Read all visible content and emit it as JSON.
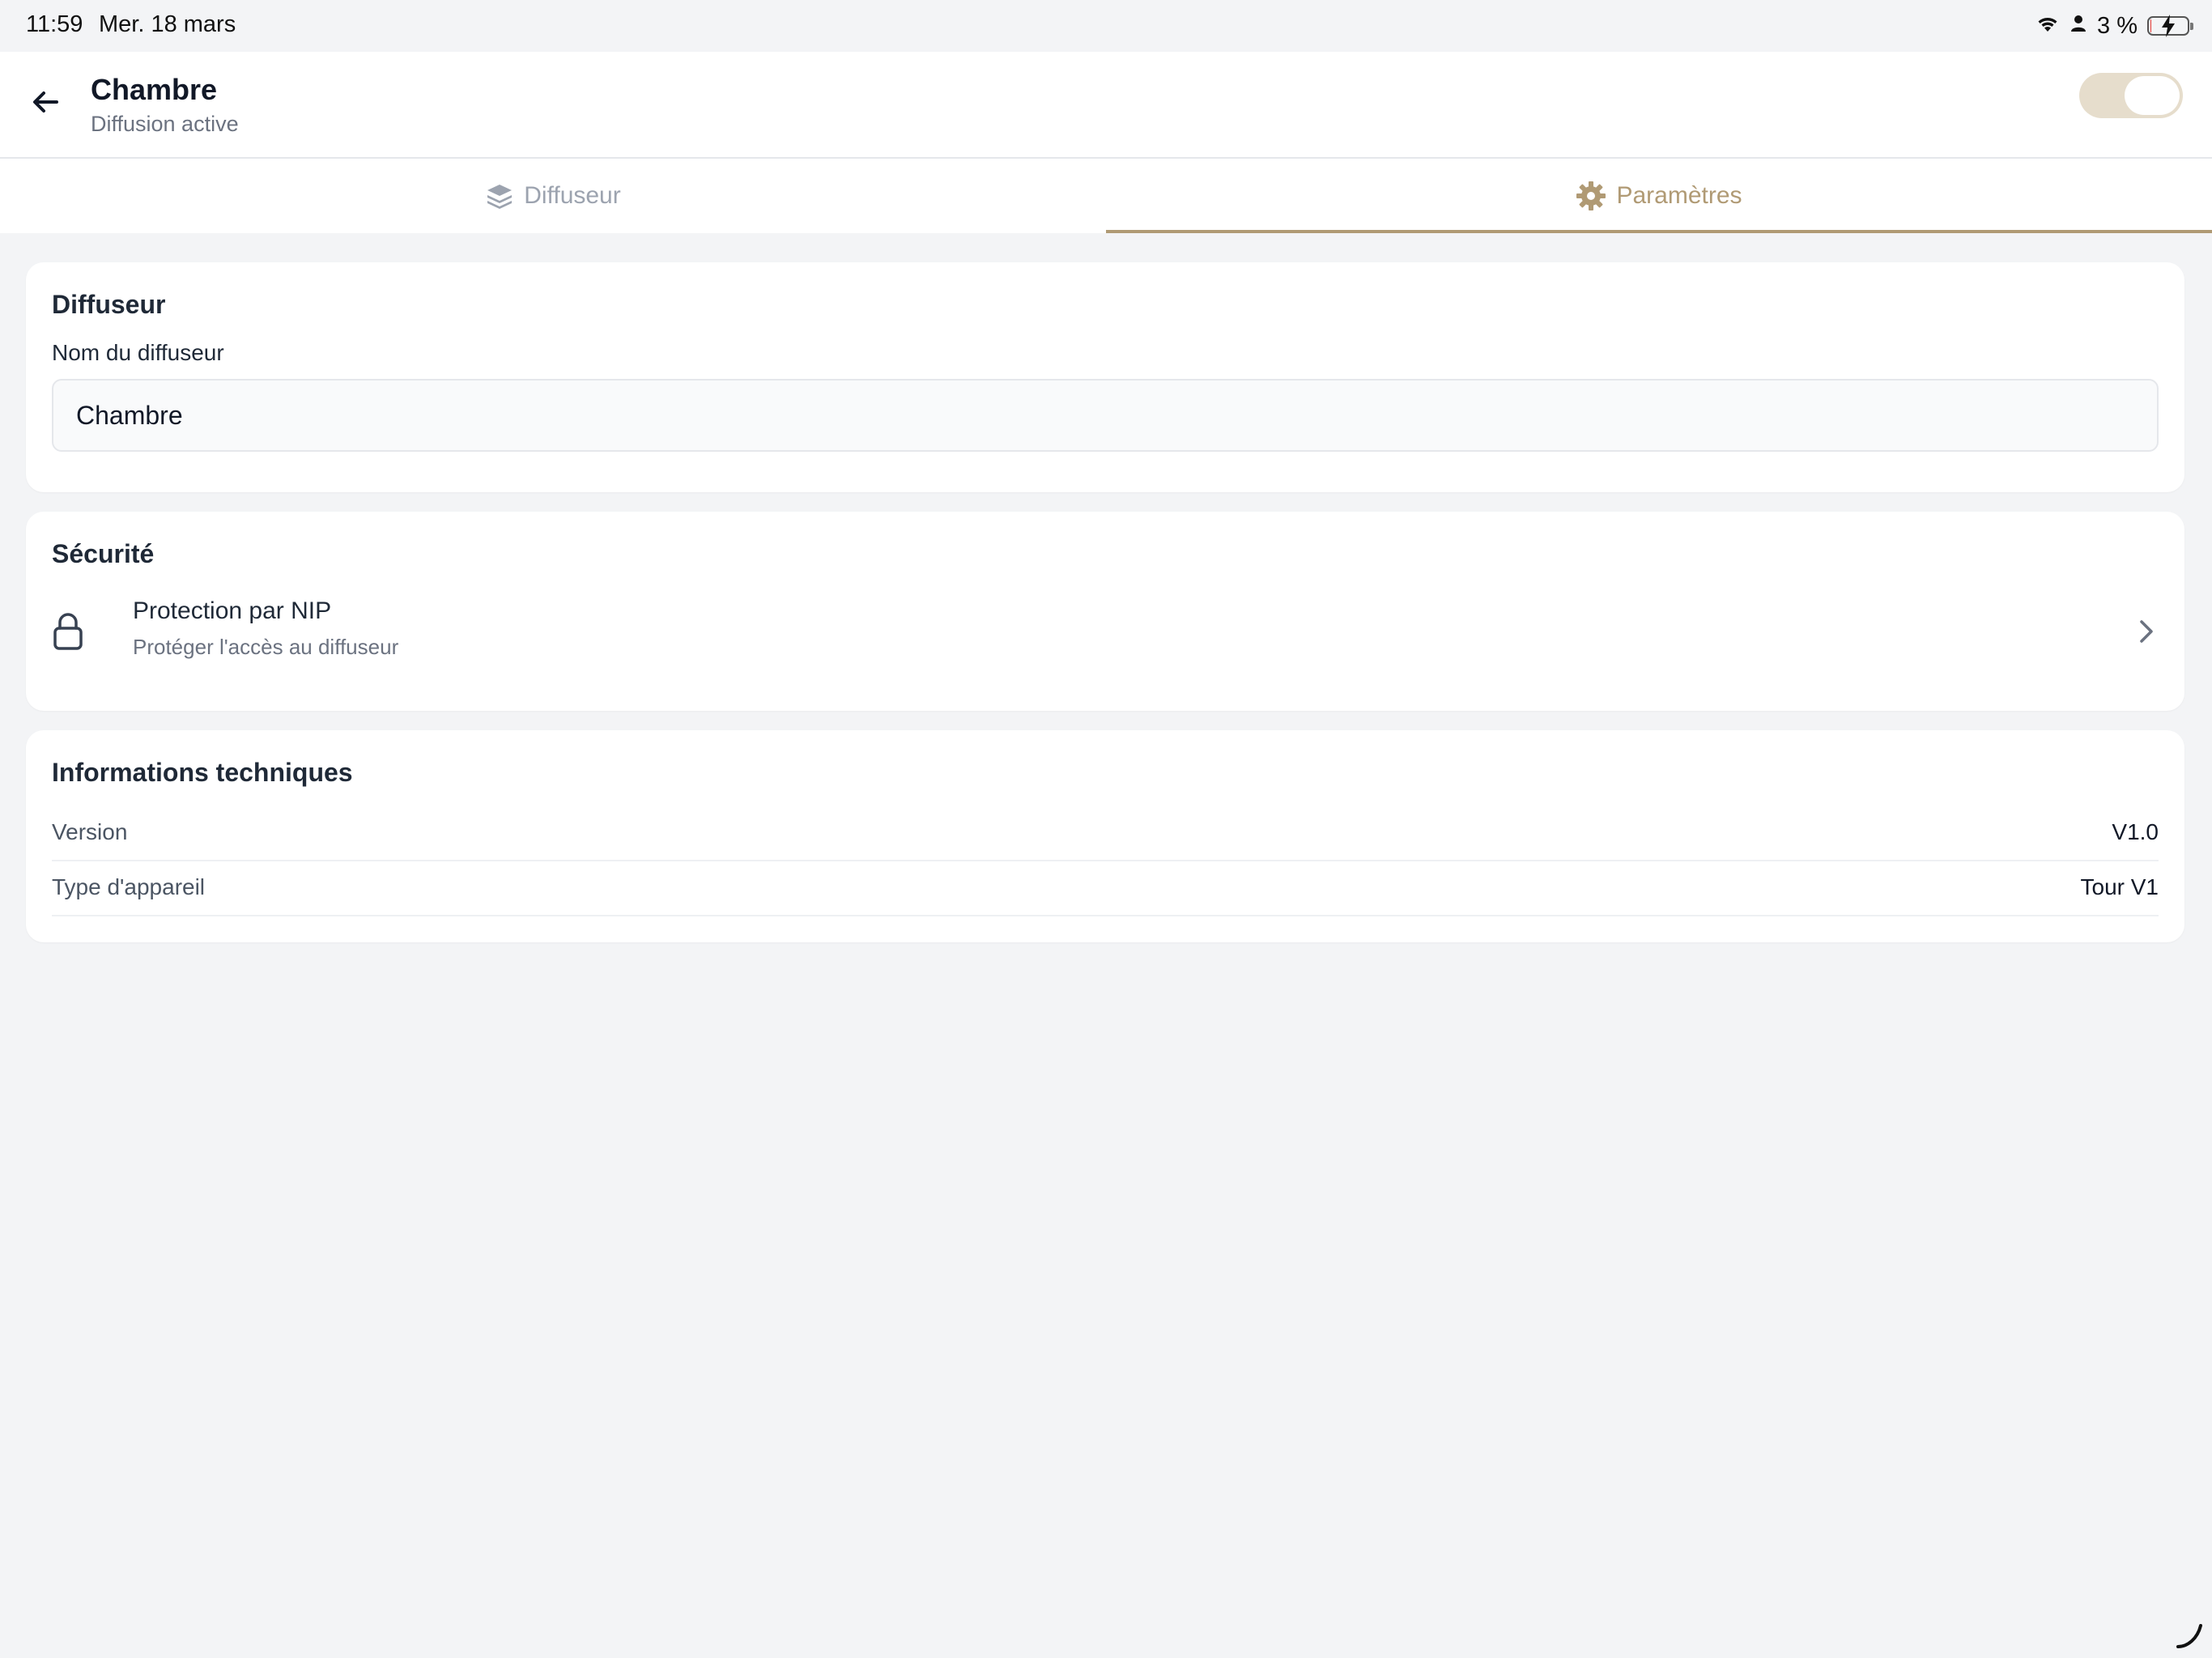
{
  "status_bar": {
    "time": "11:59",
    "date": "Mer. 18 mars",
    "battery_percent": "3 %",
    "battery_level": 0.03,
    "icons": [
      "wifi-icon",
      "person-icon",
      "battery-charging-icon"
    ]
  },
  "header": {
    "title": "Chambre",
    "subtitle": "Diffusion active",
    "back_icon": "arrow-left-icon",
    "diffusion_toggle_on": true
  },
  "tabs": [
    {
      "label": "Diffuseur",
      "icon": "layers-icon",
      "active": false
    },
    {
      "label": "Paramètres",
      "icon": "gear-icon",
      "active": true
    }
  ],
  "diffuser_card": {
    "title": "Diffuseur",
    "name_label": "Nom du diffuseur",
    "name_value": "Chambre"
  },
  "security_card": {
    "title": "Sécurité",
    "pin_label": "Protection par NIP",
    "pin_sub": "Protéger l'accès au diffuseur",
    "icon": "lock-icon"
  },
  "tech_card": {
    "title": "Informations techniques",
    "rows": [
      {
        "key": "Version",
        "value": "V1.0"
      },
      {
        "key": "Type d'appareil",
        "value": "Tour V1"
      }
    ]
  },
  "colors": {
    "accent": "#b09a74",
    "background": "#f3f4f6",
    "toggle_track": "#e6ddcc"
  }
}
